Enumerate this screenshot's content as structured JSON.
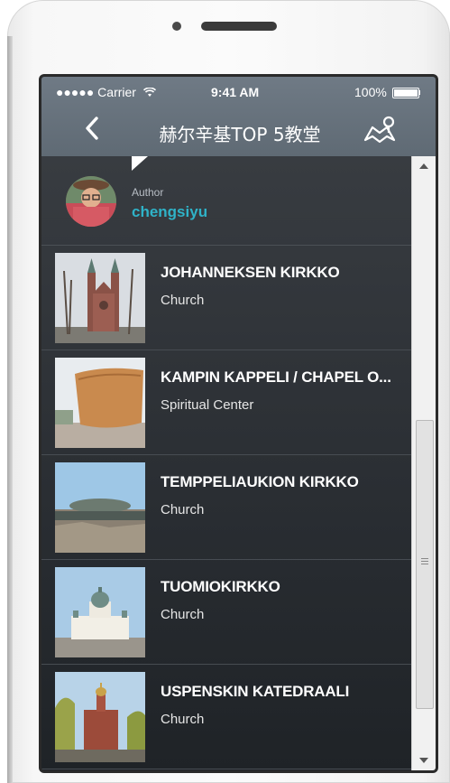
{
  "status_bar": {
    "carrier": "●●●●● Carrier",
    "time": "9:41 AM",
    "battery_text": "100%",
    "battery_level": 1.0
  },
  "nav": {
    "back_icon": "chevron-left-icon",
    "title": "赫尔辛基TOP 5教堂",
    "map_icon": "map-pin-icon"
  },
  "author": {
    "label": "Author",
    "name": "chengsiyu"
  },
  "places": [
    {
      "title": "JOHANNEKSEN KIRKKO",
      "type": "Church"
    },
    {
      "title": "KAMPIN KAPPELI / CHAPEL O...",
      "type": "Spiritual Center"
    },
    {
      "title": "TEMPPELIAUKION KIRKKO",
      "type": "Church"
    },
    {
      "title": "TUOMIOKIRKKO",
      "type": "Church"
    },
    {
      "title": "USPENSKIN KATEDRAALI",
      "type": "Church"
    }
  ],
  "colors": {
    "header": "#66717b",
    "content_bg": "#2e3237",
    "author_name": "#2fb3c8",
    "text": "#ffffff"
  }
}
